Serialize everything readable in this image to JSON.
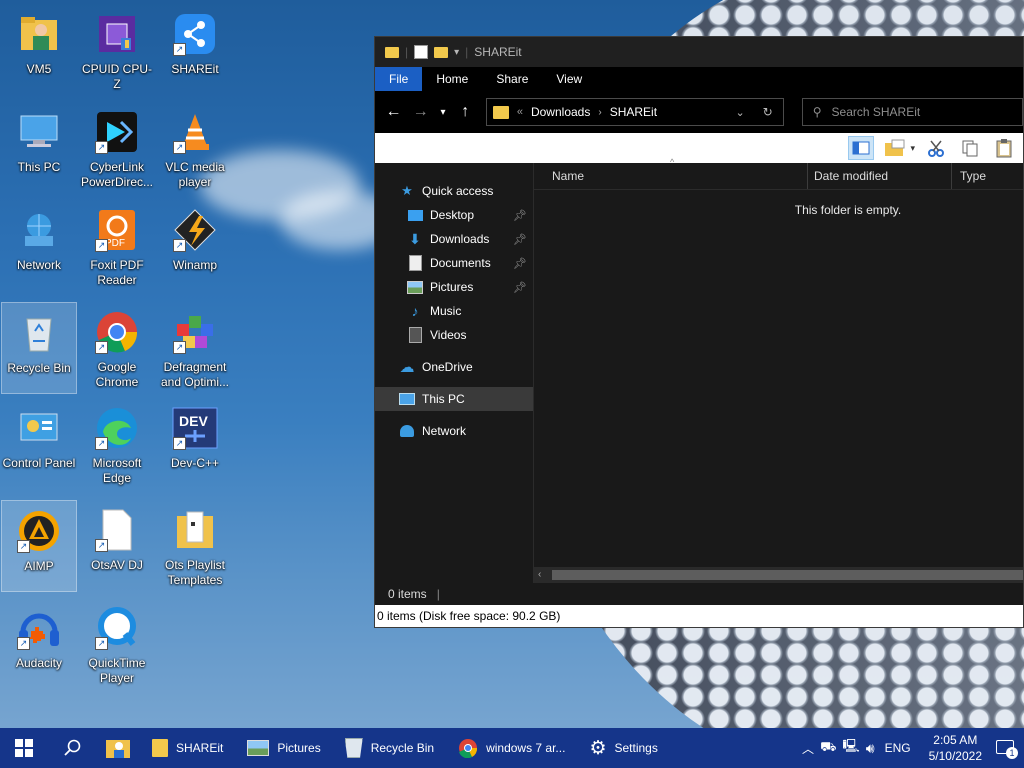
{
  "desktop": {
    "icons": [
      {
        "label": "VM5"
      },
      {
        "label": "CPUID CPU-Z"
      },
      {
        "label": "SHAREit"
      },
      {
        "label": "This PC"
      },
      {
        "label": "CyberLink PowerDirec..."
      },
      {
        "label": "VLC media player"
      },
      {
        "label": "Network"
      },
      {
        "label": "Foxit PDF Reader"
      },
      {
        "label": "Winamp"
      },
      {
        "label": "Recycle Bin"
      },
      {
        "label": "Google Chrome"
      },
      {
        "label": "Defragment and Optimi..."
      },
      {
        "label": "Control Panel"
      },
      {
        "label": "Microsoft Edge"
      },
      {
        "label": "Dev-C++"
      },
      {
        "label": "AIMP"
      },
      {
        "label": "OtsAV DJ"
      },
      {
        "label": "Ots Playlist Templates"
      },
      {
        "label": "Audacity"
      },
      {
        "label": "QuickTime Player"
      }
    ],
    "foxit_badge": "PDF",
    "dev_badge": "DEV"
  },
  "explorer": {
    "title": "SHAREit",
    "ribbon_tabs": [
      "File",
      "Home",
      "Share",
      "View"
    ],
    "breadcrumb": [
      "Downloads",
      "SHAREit"
    ],
    "breadcrumb_overflow": "«",
    "search_placeholder": "Search SHAREit",
    "nav": {
      "quick_access": "Quick access",
      "desktop": "Desktop",
      "downloads": "Downloads",
      "documents": "Documents",
      "pictures": "Pictures",
      "music": "Music",
      "videos": "Videos",
      "onedrive": "OneDrive",
      "this_pc": "This PC",
      "network": "Network"
    },
    "columns": [
      "Name",
      "Date modified",
      "Type"
    ],
    "empty_text": "This folder is empty.",
    "status_items": "0 items",
    "info_text": "0 items (Disk free space: 90.2 GB)"
  },
  "taskbar": {
    "tasks": [
      "SHAREit",
      "Pictures",
      "Recycle Bin",
      "windows 7 ar...",
      "Settings"
    ],
    "language": "ENG",
    "time": "2:05 AM",
    "date": "5/10/2022",
    "notification_count": "1"
  },
  "colors": {
    "taskbar": "#15358a",
    "file_tab": "#1b5fc4",
    "window_bg": "#191919"
  }
}
